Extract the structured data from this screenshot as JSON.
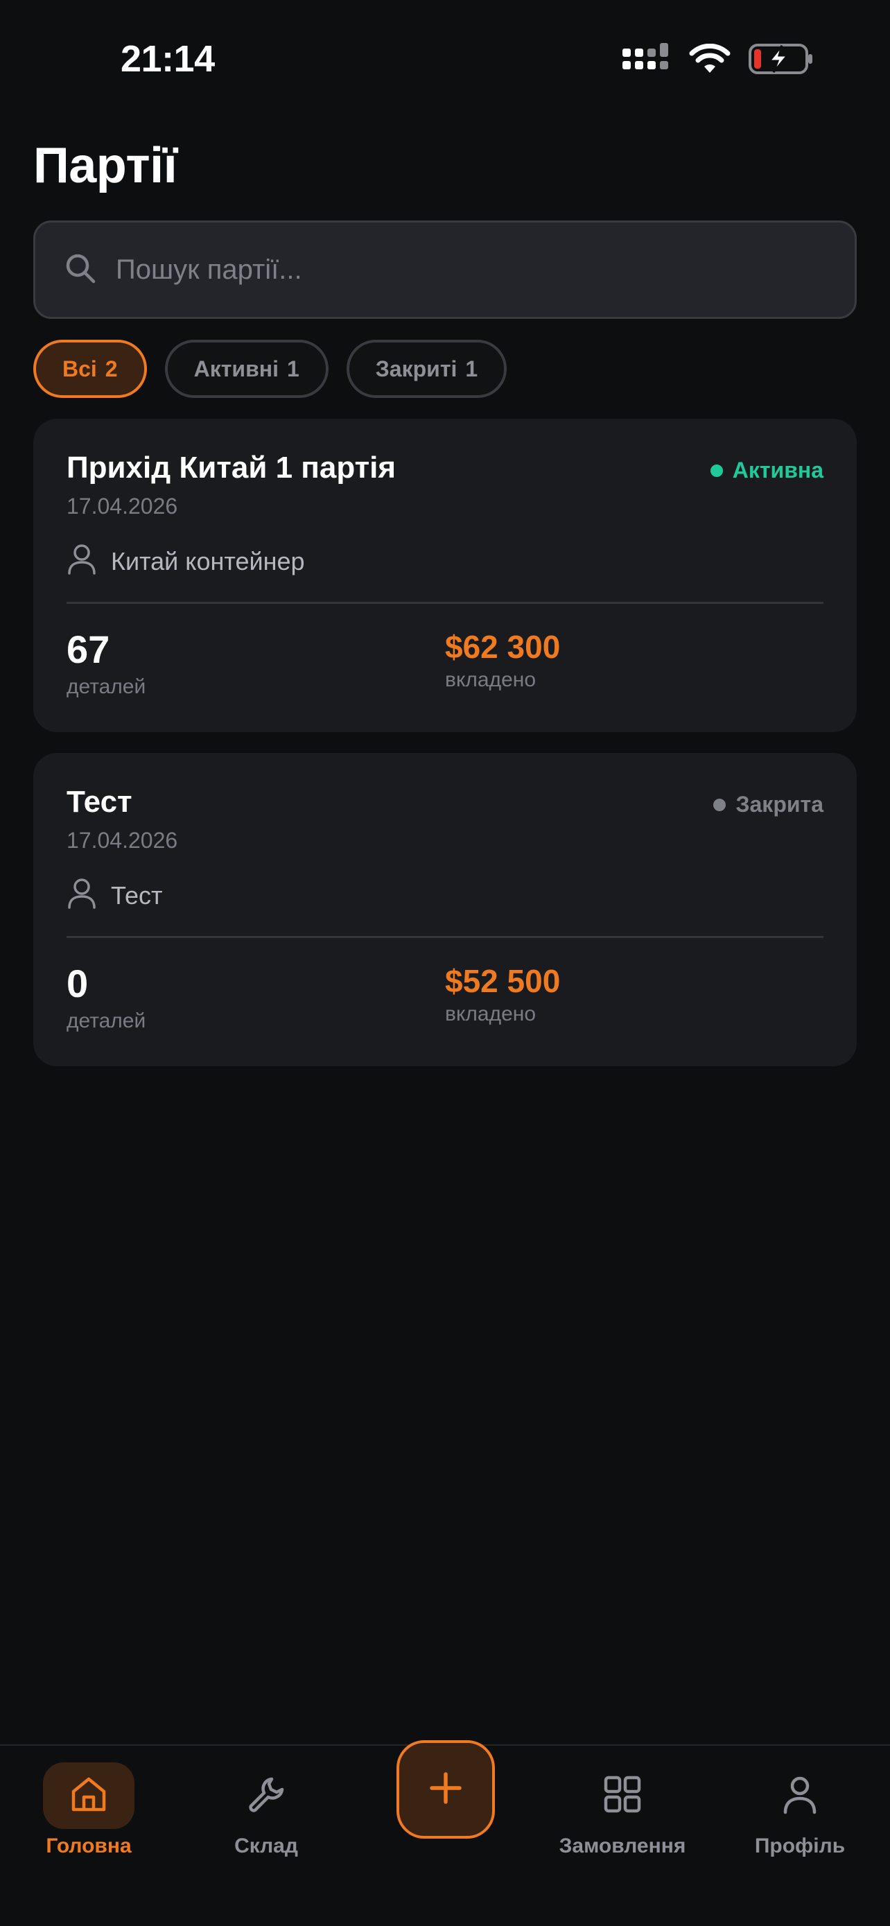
{
  "status_bar": {
    "time": "21:14",
    "icons": [
      "signal-icon",
      "wifi-icon",
      "battery-charging-icon"
    ]
  },
  "page": {
    "title": "Партії"
  },
  "search": {
    "placeholder": "Пошук партії...",
    "value": "",
    "icon": "search-icon"
  },
  "filters": [
    {
      "label": "Всі",
      "count": "2",
      "active": true
    },
    {
      "label": "Активні",
      "count": "1",
      "active": false
    },
    {
      "label": "Закриті",
      "count": "1",
      "active": false
    }
  ],
  "batches": [
    {
      "name": "Прихід Китай 1 партія",
      "date": "17.04.2026",
      "status": "Активна",
      "status_color": "#1ec99a",
      "supplier": "Китай контейнер",
      "supplier_icon": "user-icon",
      "parts_count": "67",
      "parts_label": "деталей",
      "amount": "$62 300",
      "amount_label": "вкладено"
    },
    {
      "name": "Тест",
      "date": "17.04.2026",
      "status": "Закрита",
      "status_color": "#7f8189",
      "supplier": "Тест",
      "supplier_icon": "user-icon",
      "parts_count": "0",
      "parts_label": "деталей",
      "amount": "$52 500",
      "amount_label": "вкладено"
    }
  ],
  "tab_bar": {
    "home": {
      "label": "Головна",
      "icon": "home-icon",
      "active": true
    },
    "stock": {
      "label": "Склад",
      "icon": "wrench-icon",
      "active": false
    },
    "add": {
      "icon": "plus-icon"
    },
    "orders": {
      "label": "Замовлення",
      "icon": "grid-icon",
      "active": false
    },
    "profile": {
      "label": "Профіль",
      "icon": "profile-icon",
      "active": false
    }
  },
  "colors": {
    "accent": "#f07a1f",
    "background": "#0d0e10",
    "card": "#1a1b1f",
    "active_status": "#1ec99a",
    "closed_status": "#7f8189"
  }
}
